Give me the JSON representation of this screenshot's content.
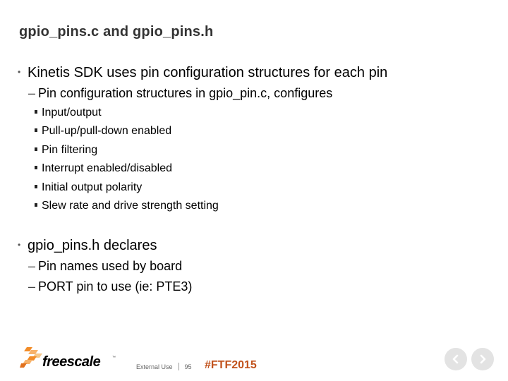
{
  "slide": {
    "title": "gpio_pins.c and gpio_pins.h",
    "bullets": [
      {
        "text": "Kinetis SDK uses pin configuration structures for each pin",
        "sub": [
          {
            "text": "Pin configuration structures in gpio_pin.c, configures",
            "sub": [
              "Input/output",
              "Pull-up/pull-down enabled",
              "Pin filtering",
              "Interrupt enabled/disabled",
              "Initial output polarity",
              "Slew rate and drive strength setting"
            ]
          }
        ]
      },
      {
        "text": "gpio_pins.h declares",
        "sub": [
          {
            "text": "Pin names used by board"
          },
          {
            "text": "PORT pin to use (ie: PTE3)"
          }
        ]
      }
    ]
  },
  "footer": {
    "logo_text": "freescale",
    "logo_tm": "™",
    "classification": "External Use",
    "page_number": "95",
    "hashtag": "#FTF2015",
    "hashtag_color": "#c1521c"
  },
  "symbols": {
    "bullet_l1": "•",
    "bullet_l2": "–"
  },
  "nav": {
    "prev_icon": "chevron-left-icon",
    "next_icon": "chevron-right-icon"
  }
}
